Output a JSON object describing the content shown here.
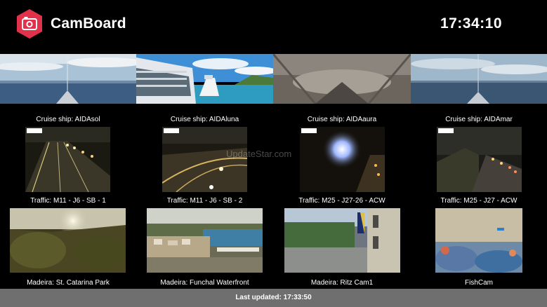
{
  "header": {
    "app_title": "CamBoard",
    "clock": "17:34:10",
    "logo_icon": "camera-icon",
    "accent_color": "#e0324b"
  },
  "cameras": [
    {
      "label": "Cruise ship: AIDAsol"
    },
    {
      "label": "Cruise ship: AIDAluna"
    },
    {
      "label": "Cruise ship: AIDAaura"
    },
    {
      "label": "Cruise ship: AIDAmar"
    },
    {
      "label": "Traffic: M11 - J6 - SB - 1"
    },
    {
      "label": "Traffic: M11 - J6 - SB - 2"
    },
    {
      "label": "Traffic: M25 - J27-26 - ACW"
    },
    {
      "label": "Traffic: M25 - J27 - ACW"
    },
    {
      "label": "Madeira: St. Catarina Park"
    },
    {
      "label": "Madeira: Funchal Waterfront"
    },
    {
      "label": "Madeira: Ritz Cam1"
    },
    {
      "label": "FishCam"
    }
  ],
  "footer": {
    "last_updated": "Last updated: 17:33:50"
  },
  "watermark": "UpdateStar.com"
}
